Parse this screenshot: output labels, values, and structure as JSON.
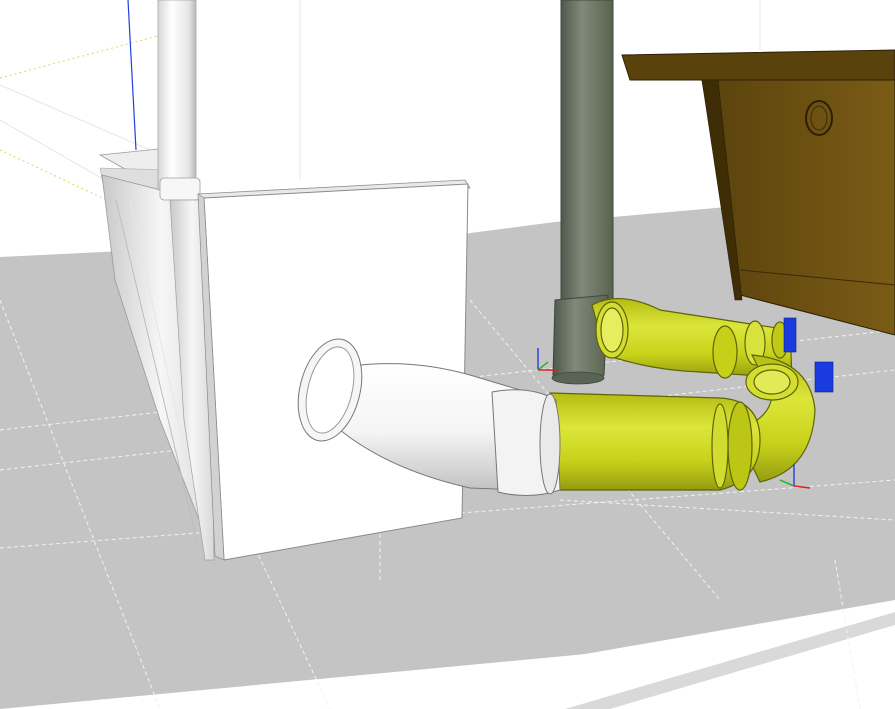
{
  "scene": {
    "colors": {
      "background": "#ffffff",
      "floor": "#c4c4c4",
      "floor_edge": "#8a8a8a",
      "guide_line": "#e8e8e8",
      "axis_red": "#e02020",
      "axis_green": "#22aa22",
      "axis_blue": "#2040e0",
      "axis_yellow_dotted": "#d8d860",
      "white_pipe": "#f2f2f2",
      "white_pipe_shadow": "#b8b8b8",
      "green_pipe": "#c8d21a",
      "green_pipe_dark": "#8c9410",
      "green_pipe_light": "#e4ec54",
      "gray_pipe": "#6d7868",
      "gray_pipe_dark": "#4a5348",
      "cabinet_brown": "#6e5110",
      "cabinet_dark": "#4a3508",
      "cabinet_top": "#5a420c",
      "panel_white": "#ffffff",
      "panel_blue_marker": "#1a3be0"
    },
    "objects": [
      "wall-panel",
      "white-vertical-pipe",
      "wall-bracket",
      "white-elbow-pipe",
      "green-trap-pipes",
      "gray-vertical-pipe",
      "brown-cabinet",
      "floor-slab",
      "axis-markers"
    ]
  }
}
